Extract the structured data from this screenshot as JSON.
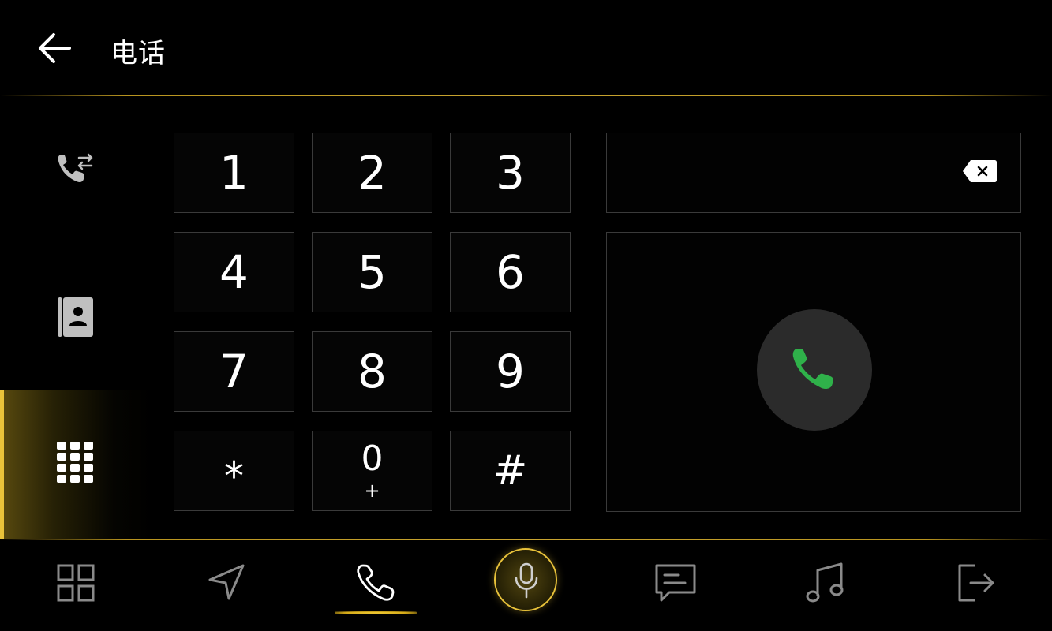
{
  "header": {
    "title": "电话",
    "back_icon": "arrow-left-icon"
  },
  "sidebar": {
    "items": [
      {
        "id": "recent-calls",
        "icon": "call-transfer-icon",
        "active": false
      },
      {
        "id": "contacts",
        "icon": "contact-book-icon",
        "active": false
      },
      {
        "id": "dialpad",
        "icon": "dialpad-grid-icon",
        "active": true
      }
    ]
  },
  "keypad": {
    "keys": [
      {
        "digit": "1",
        "sub": ""
      },
      {
        "digit": "2",
        "sub": ""
      },
      {
        "digit": "3",
        "sub": ""
      },
      {
        "digit": "4",
        "sub": ""
      },
      {
        "digit": "5",
        "sub": ""
      },
      {
        "digit": "6",
        "sub": ""
      },
      {
        "digit": "7",
        "sub": ""
      },
      {
        "digit": "8",
        "sub": ""
      },
      {
        "digit": "9",
        "sub": ""
      },
      {
        "digit": "*",
        "sub": ""
      },
      {
        "digit": "0",
        "sub": "+"
      },
      {
        "digit": "#",
        "sub": ""
      }
    ]
  },
  "number_display": {
    "value": "",
    "backspace_icon": "backspace-icon"
  },
  "call_button": {
    "icon": "phone-icon",
    "color": "#2fb14a"
  },
  "bottom_nav": {
    "items": [
      {
        "id": "apps",
        "icon": "app-grid-icon",
        "active": false
      },
      {
        "id": "navigation",
        "icon": "navigation-arrow-icon",
        "active": false
      },
      {
        "id": "phone",
        "icon": "phone-icon",
        "active": true
      },
      {
        "id": "voice",
        "icon": "microphone-icon",
        "active": false
      },
      {
        "id": "messages",
        "icon": "message-icon",
        "active": false
      },
      {
        "id": "music",
        "icon": "music-note-icon",
        "active": false
      },
      {
        "id": "exit",
        "icon": "exit-icon",
        "active": false
      }
    ]
  },
  "colors": {
    "accent": "#e8c23a",
    "background": "#000000",
    "key_border": "#3a3a3a",
    "call_green": "#2fb14a"
  }
}
